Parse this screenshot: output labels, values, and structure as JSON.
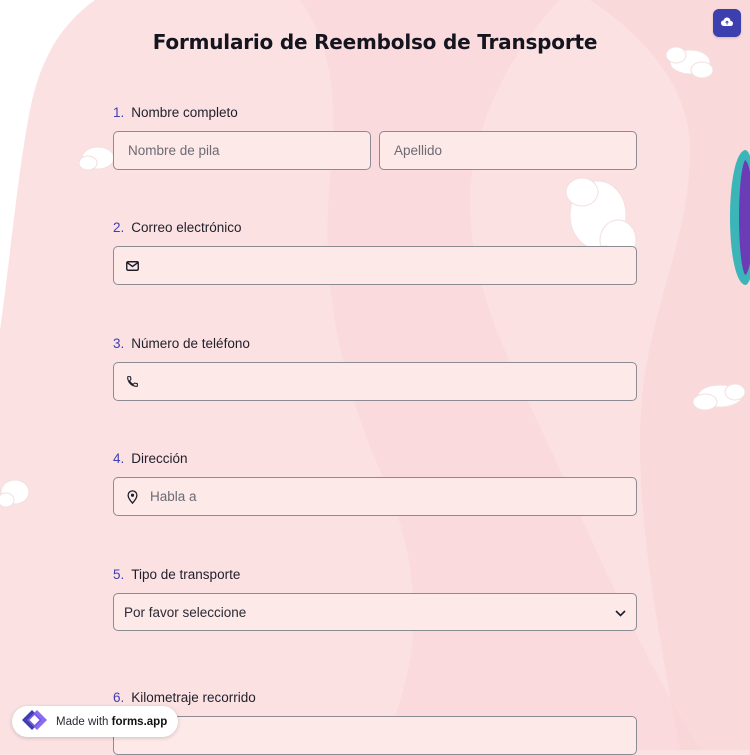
{
  "form": {
    "title": "Formulario de Reembolso de Transporte",
    "questions": [
      {
        "number": "1.",
        "label": "Nombre completo",
        "first_placeholder": "Nombre de pila",
        "last_placeholder": "Apellido"
      },
      {
        "number": "2.",
        "label": "Correo electrónico",
        "icon": "envelope-icon"
      },
      {
        "number": "3.",
        "label": "Número de teléfono",
        "icon": "phone-icon"
      },
      {
        "number": "4.",
        "label": "Dirección",
        "icon": "map-pin-icon",
        "placeholder": "Habla a"
      },
      {
        "number": "5.",
        "label": "Tipo de transporte",
        "selected": "Por favor seleccione",
        "icon": "chevron-down-icon"
      },
      {
        "number": "6.",
        "label": "Kilometraje recorrido"
      }
    ]
  },
  "toolbar": {
    "save_icon": "cloud-upload-icon"
  },
  "footer": {
    "badge_prefix": "Made with",
    "badge_brand": "forms.app"
  },
  "colors": {
    "accent": "#3d3fae",
    "background": "#fbe1e2",
    "field_bg": "#fde9e8"
  }
}
